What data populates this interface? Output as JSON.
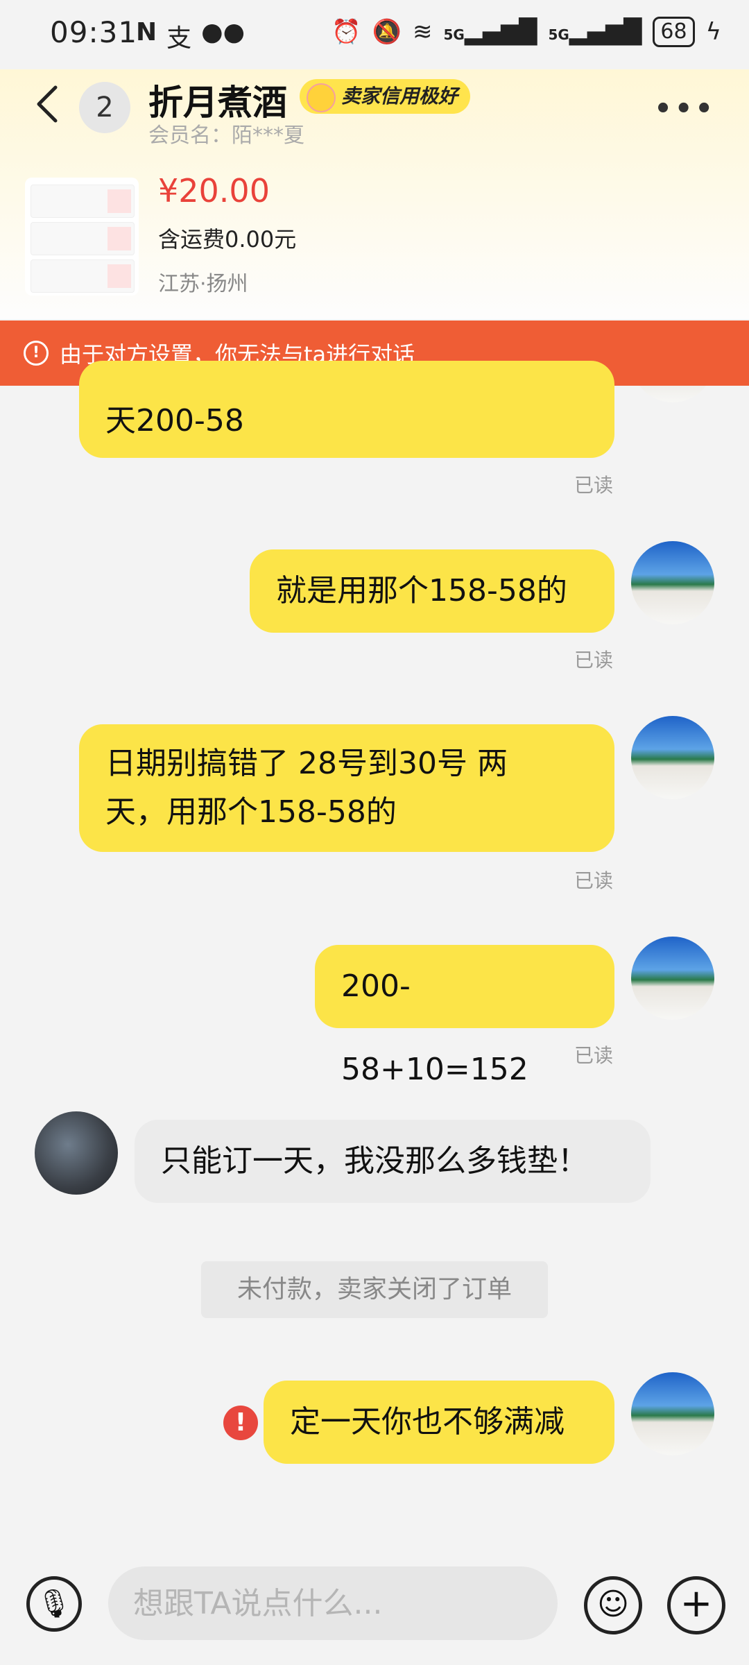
{
  "status_bar": {
    "time": "09:31",
    "left_icons": [
      "N",
      "支",
      "wechat-icon"
    ],
    "signal1": "5G",
    "signal2": "5G",
    "battery": "68"
  },
  "header": {
    "unread_count": "2",
    "seller_name": "折月煮酒",
    "credit_badge": "卖家信用极好",
    "member_name": "会员名：陌***夏"
  },
  "product": {
    "price": "¥20.00",
    "shipping": "含运费0.00元",
    "location": "江苏·扬州"
  },
  "warning": {
    "text": "由于对方设置，你无法与ta进行对话"
  },
  "messages": [
    {
      "side": "self",
      "text": "天200-58",
      "status": "已读"
    },
    {
      "side": "self",
      "text": "就是用那个158-58的",
      "status": "已读"
    },
    {
      "side": "self",
      "line1": "日期别搞错了 28号到30号 两",
      "line2": "天，用那个158-58的",
      "status": "已读"
    },
    {
      "side": "self",
      "text": "200-58+10=152",
      "status": "已读"
    },
    {
      "side": "other",
      "text": "只能订一天，我没那么多钱垫！"
    },
    {
      "side": "self",
      "text": "定一天你也不够满减",
      "error": "!"
    }
  ],
  "system_notice": "未付款，卖家关闭了订单",
  "input": {
    "placeholder": "想跟TA说点什么..."
  },
  "colors": {
    "bubble_self": "#fce448",
    "bubble_other": "#ebebeb",
    "warning_bar": "#ef5d35",
    "price": "#e9423a"
  }
}
